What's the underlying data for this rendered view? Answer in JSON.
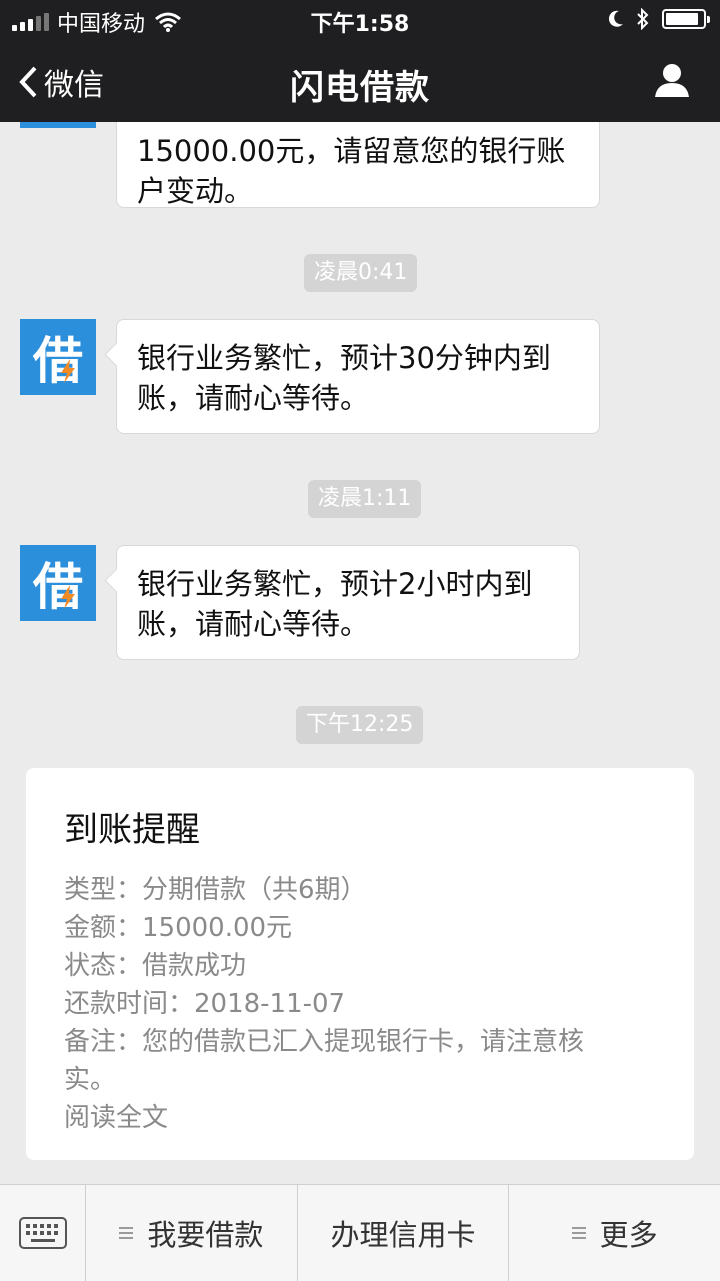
{
  "status_bar": {
    "carrier": "中国移动",
    "time": "下午1:58"
  },
  "nav": {
    "back_label": "微信",
    "title": "闪电借款"
  },
  "avatar_char": "借",
  "messages": [
    {
      "text_line1": "15000.00元，请留意您的银行账",
      "text_line2": "户变动。"
    },
    {
      "time": "凌晨0:41",
      "text_line1": "银行业务繁忙，预计30分钟内到",
      "text_line2": "账，请耐心等待。"
    },
    {
      "time": "凌晨1:11",
      "text_line1": "银行业务繁忙，预计2小时内到",
      "text_line2": "账，请耐心等待。"
    },
    {
      "time": "下午12:25"
    }
  ],
  "card": {
    "title": "到账提醒",
    "type_line": "类型：分期借款（共6期）",
    "amount_line": "金额：15000.00元",
    "status_line": "状态：借款成功",
    "repay_line": "还款时间：2018-11-07",
    "note_line1": "备注：您的借款已汇入提现银行卡，请注意核",
    "note_line2": "实。",
    "read_more": "阅读全文"
  },
  "bottom_menu": {
    "item1": "我要借款",
    "item2": "办理信用卡",
    "item3": "更多"
  },
  "colors": {
    "header_bg": "#1f1f21",
    "chat_bg": "#ebebeb",
    "avatar_bg": "#2c8fdc",
    "bolt": "#f08a24"
  }
}
